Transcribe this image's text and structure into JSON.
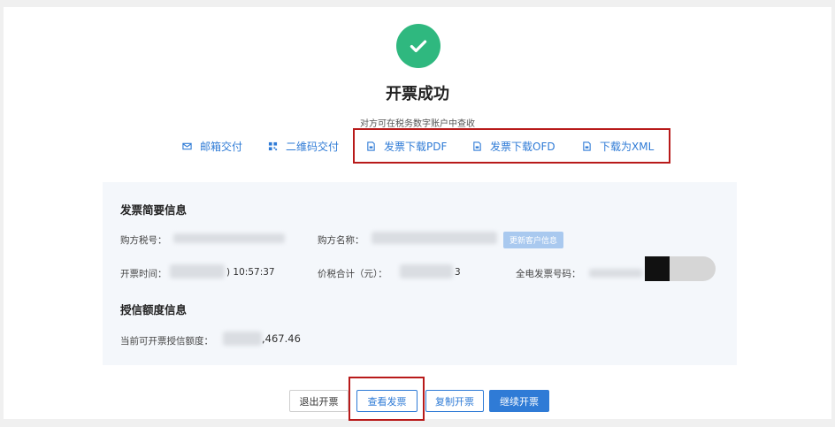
{
  "header": {
    "title": "开票成功",
    "subtitle": "对方可在税务数字账户中查收"
  },
  "actions": [
    {
      "label": "邮箱交付",
      "icon": "mail-icon"
    },
    {
      "label": "二维码交付",
      "icon": "qrcode-icon"
    },
    {
      "label": "发票下载PDF",
      "icon": "file-pdf-icon"
    },
    {
      "label": "发票下载OFD",
      "icon": "file-ofd-icon"
    },
    {
      "label": "下载为XML",
      "icon": "file-xml-icon"
    }
  ],
  "summary": {
    "title": "发票简要信息",
    "buyer_tax_label": "购方税号：",
    "buyer_name_label": "购方名称：",
    "update_button": "更新客户信息",
    "invoice_time_label": "开票时间：",
    "invoice_time_visible": ") 10:57:37",
    "total_label": "价税合计（元）：",
    "total_visible_suffix": "3",
    "invoice_no_label": "全电发票号码："
  },
  "credit": {
    "title": "授信额度信息",
    "label": "当前可开票授信额度：",
    "value_visible": ",467.46"
  },
  "buttons": {
    "exit": "退出开票",
    "view": "查看发票",
    "copy": "复制开票",
    "continue": "继续开票"
  },
  "colors": {
    "success": "#2fb87f",
    "link": "#2f7bd6",
    "highlight": "#b81a1a"
  }
}
